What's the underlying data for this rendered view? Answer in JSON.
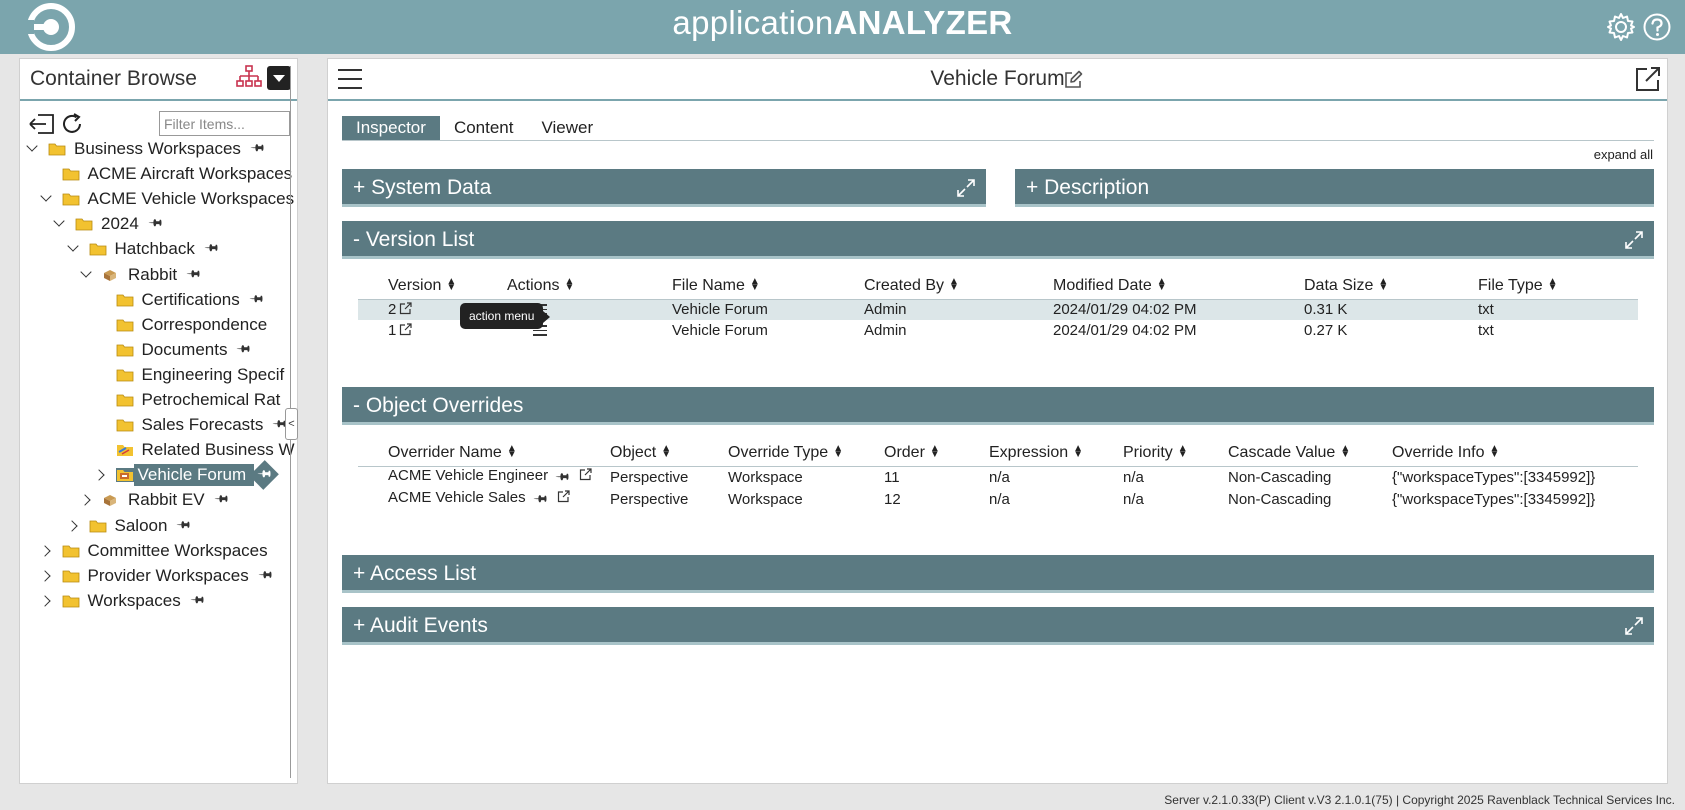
{
  "app": {
    "title_light": "application",
    "title_bold": "ANALYZER"
  },
  "browser": {
    "title": "Container Browse",
    "filter_placeholder": "Filter Items...",
    "tree": [
      {
        "label": "Business Workspaces",
        "level": 0,
        "chevron": "down",
        "icon": "folder",
        "pin": true
      },
      {
        "label": "ACME Aircraft Workspaces",
        "level": 1,
        "chevron": "none",
        "icon": "folder",
        "pin": false
      },
      {
        "label": "ACME Vehicle Workspaces",
        "level": 1,
        "chevron": "down",
        "icon": "folder",
        "pin": false
      },
      {
        "label": "2024",
        "level": 2,
        "chevron": "down",
        "icon": "folder",
        "pin": true
      },
      {
        "label": "Hatchback",
        "level": 3,
        "chevron": "down",
        "icon": "folder",
        "pin": true
      },
      {
        "label": "Rabbit",
        "level": 4,
        "chevron": "down",
        "icon": "business-workspace",
        "pin": true
      },
      {
        "label": "Certifications",
        "level": 5,
        "chevron": "none",
        "icon": "folder",
        "pin": true
      },
      {
        "label": "Correspondence",
        "level": 5,
        "chevron": "none",
        "icon": "folder",
        "pin": false
      },
      {
        "label": "Documents",
        "level": 5,
        "chevron": "none",
        "icon": "folder",
        "pin": true
      },
      {
        "label": "Engineering Specif",
        "level": 5,
        "chevron": "none",
        "icon": "folder",
        "pin": false
      },
      {
        "label": "Petrochemical Rat",
        "level": 5,
        "chevron": "none",
        "icon": "folder",
        "pin": false
      },
      {
        "label": "Sales Forecasts",
        "level": 5,
        "chevron": "none",
        "icon": "folder",
        "pin": true
      },
      {
        "label": "Related Business W",
        "level": 5,
        "chevron": "none",
        "icon": "related-workspaces",
        "pin": false
      },
      {
        "label": "Vehicle Forum",
        "level": 5,
        "chevron": "right",
        "icon": "forum",
        "pin": true,
        "selected": true
      },
      {
        "label": "Rabbit EV",
        "level": 4,
        "chevron": "right",
        "icon": "business-workspace",
        "pin": true
      },
      {
        "label": "Saloon",
        "level": 3,
        "chevron": "right",
        "icon": "folder",
        "pin": true
      },
      {
        "label": "Committee Workspaces",
        "level": 1,
        "chevron": "right",
        "icon": "folder",
        "pin": false
      },
      {
        "label": "Provider Workspaces",
        "level": 1,
        "chevron": "right",
        "icon": "folder",
        "pin": true
      },
      {
        "label": "Workspaces",
        "level": 1,
        "chevron": "right",
        "icon": "folder",
        "pin": true
      }
    ]
  },
  "main": {
    "object_title": "Vehicle Forum",
    "tabs": [
      {
        "label": "Inspector",
        "active": true
      },
      {
        "label": "Content",
        "active": false
      },
      {
        "label": "Viewer",
        "active": false
      }
    ],
    "expand_all": "expand all",
    "sections": {
      "system_data": "+ System Data",
      "description": "+ Description",
      "version_list": "- Version List",
      "object_overrides": "- Object Overrides",
      "access_list": "+ Access List",
      "audit_events": "+ Audit Events"
    },
    "versions": {
      "columns": [
        "Version",
        "Actions",
        "File Name",
        "Created By",
        "Modified Date",
        "Data Size",
        "File Type"
      ],
      "rows": [
        {
          "version": "2",
          "file_name": "Vehicle Forum",
          "created_by": "Admin",
          "modified": "2024/01/29 04:02 PM",
          "size": "0.31 K",
          "type": "txt",
          "highlight": true
        },
        {
          "version": "1",
          "file_name": "Vehicle Forum",
          "created_by": "Admin",
          "modified": "2024/01/29 04:02 PM",
          "size": "0.27 K",
          "type": "txt",
          "highlight": false
        }
      ],
      "tooltip": "action menu"
    },
    "overrides": {
      "columns": [
        "Overrider Name",
        "Object",
        "Override Type",
        "Order",
        "Expression",
        "Priority",
        "Cascade Value",
        "Override Info"
      ],
      "rows": [
        {
          "name": "ACME Vehicle Engineer",
          "object": "Perspective",
          "type": "Workspace",
          "order": "11",
          "expression": "n/a",
          "priority": "n/a",
          "cascade": "Non-Cascading",
          "info": "{\"workspaceTypes\":[3345992]}"
        },
        {
          "name": "ACME Vehicle Sales",
          "object": "Perspective",
          "type": "Workspace",
          "order": "12",
          "expression": "n/a",
          "priority": "n/a",
          "cascade": "Non-Cascading",
          "info": "{\"workspaceTypes\":[3345992]}"
        }
      ]
    }
  },
  "footer": "Server v.2.1.0.33(P) Client v.V3 2.1.0.1(75) | Copyright 2025 Ravenblack Technical Services Inc.",
  "colors": {
    "header": "#7ba5ad",
    "section_bar": "#5b7a82",
    "row_highlight": "#dce6e8",
    "folder": "#f2c230"
  }
}
